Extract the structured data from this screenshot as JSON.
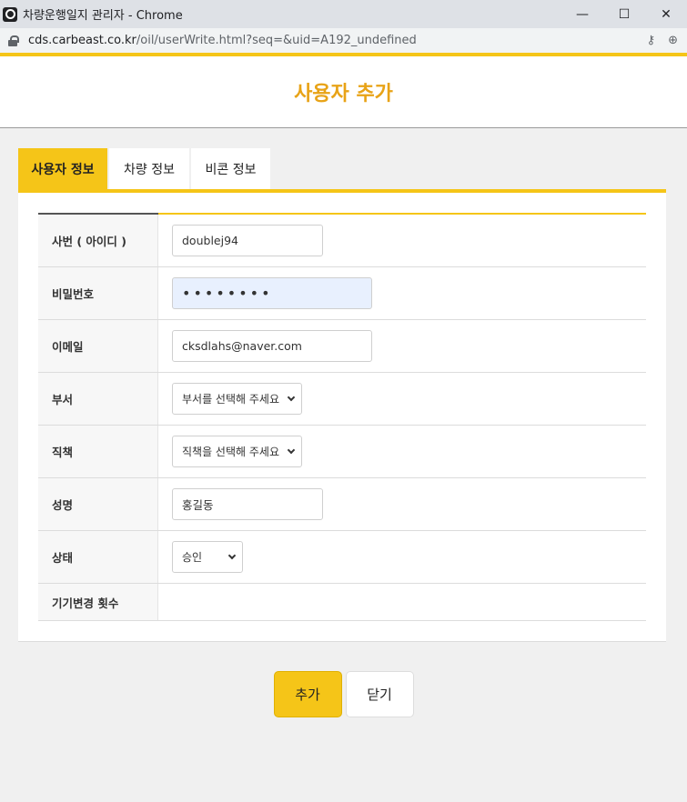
{
  "window": {
    "title": "차량운행일지 관리자 - Chrome",
    "minimize_label": "—",
    "maximize_label": "☐",
    "close_label": "✕"
  },
  "address": {
    "domain": "cds.carbeast.co.kr",
    "path": "/oil/userWrite.html?seq=&uid=A192_undefined",
    "key_icon": "⚷",
    "zoom_icon": "⊕"
  },
  "page": {
    "title": "사용자 추가"
  },
  "tabs": [
    {
      "label": "사용자 정보",
      "active": true
    },
    {
      "label": "차량 정보",
      "active": false
    },
    {
      "label": "비콘 정보",
      "active": false
    }
  ],
  "form": {
    "employee_id": {
      "label": "사번 ( 아이디 )",
      "value": "doublej94"
    },
    "password": {
      "label": "비밀번호",
      "value": "••••••••"
    },
    "email": {
      "label": "이메일",
      "value": "cksdlahs@naver.com"
    },
    "department": {
      "label": "부서",
      "value": "부서를 선택해 주세요"
    },
    "position": {
      "label": "직책",
      "value": "직책을 선택해 주세요"
    },
    "name": {
      "label": "성명",
      "value": "홍길동"
    },
    "status": {
      "label": "상태",
      "value": "승인"
    },
    "device_change_count": {
      "label": "기기변경 횟수",
      "value": ""
    }
  },
  "actions": {
    "add_label": "추가",
    "close_label": "닫기"
  },
  "colors": {
    "accent": "#f5c518",
    "title": "#e8a317"
  }
}
